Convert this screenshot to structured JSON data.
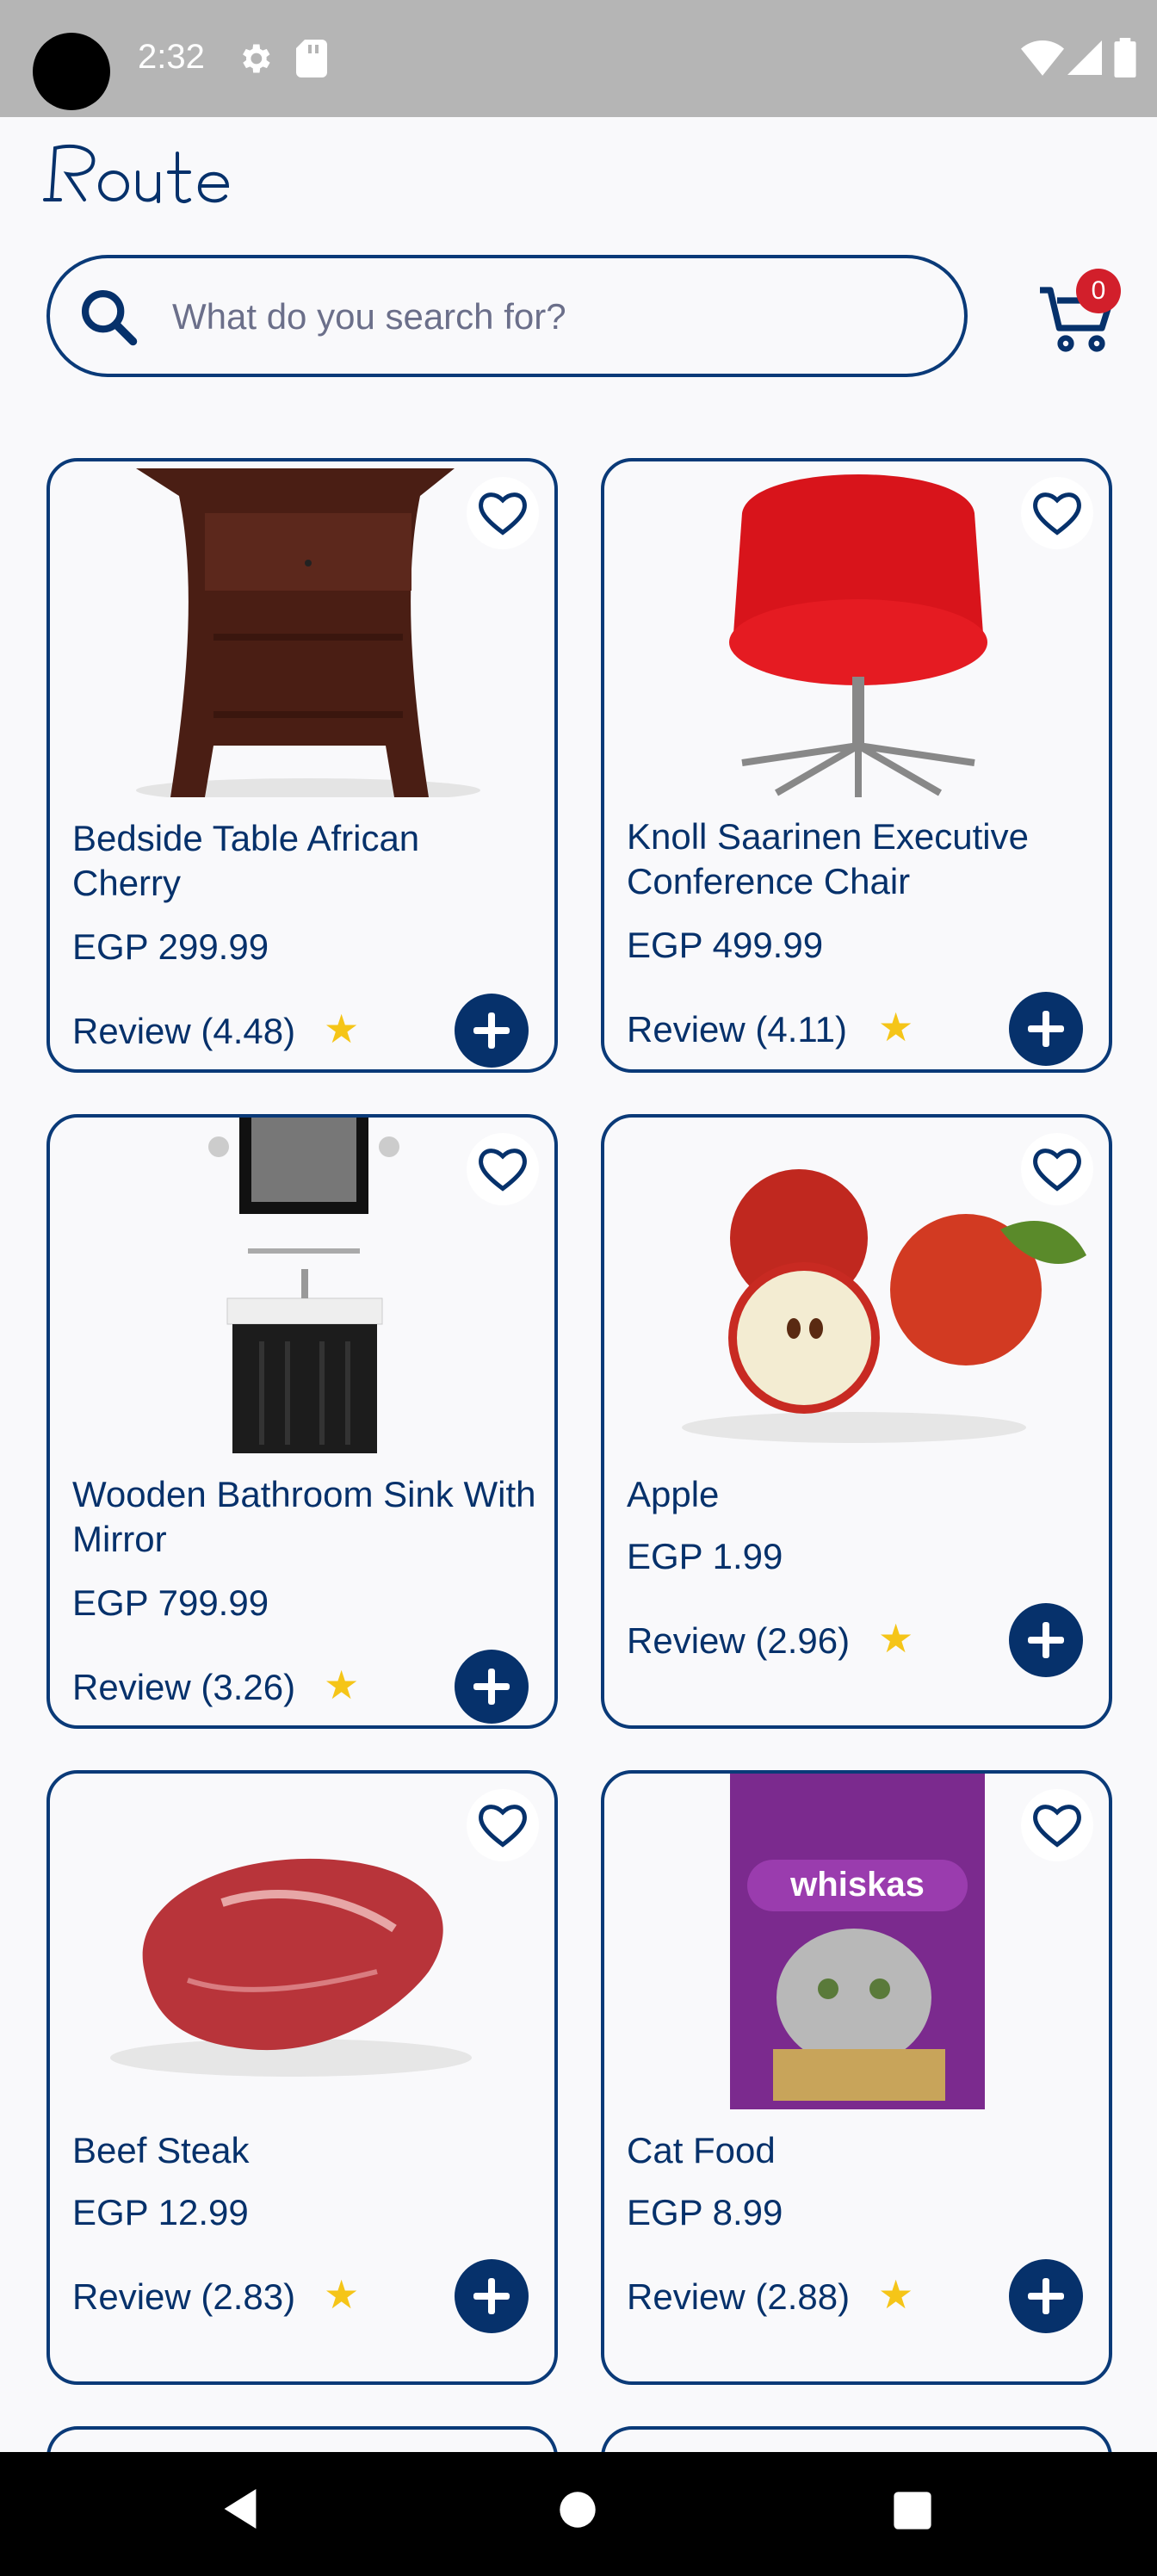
{
  "status_bar": {
    "time": "2:32"
  },
  "app": {
    "logo_text": "Route"
  },
  "search": {
    "placeholder": "What do you search for?"
  },
  "cart": {
    "count": "0"
  },
  "products": [
    {
      "title": "Bedside Table African Cherry",
      "price": "EGP 299.99",
      "review": "Review (4.48)"
    },
    {
      "title": "Knoll Saarinen Executive Conference Chair",
      "price": "EGP 499.99",
      "review": "Review (4.11)"
    },
    {
      "title": "Wooden Bathroom Sink With Mirror",
      "price": "EGP 799.99",
      "review": "Review (3.26)"
    },
    {
      "title": "Apple",
      "price": "EGP 1.99",
      "review": "Review (2.96)"
    },
    {
      "title": "Beef Steak",
      "price": "EGP 12.99",
      "review": "Review (2.83)"
    },
    {
      "title": "Cat Food",
      "price": "EGP 8.99",
      "review": "Review (2.88)"
    }
  ],
  "colors": {
    "primary": "#06316b",
    "star": "#f5c518",
    "badge": "#d21f2b"
  }
}
